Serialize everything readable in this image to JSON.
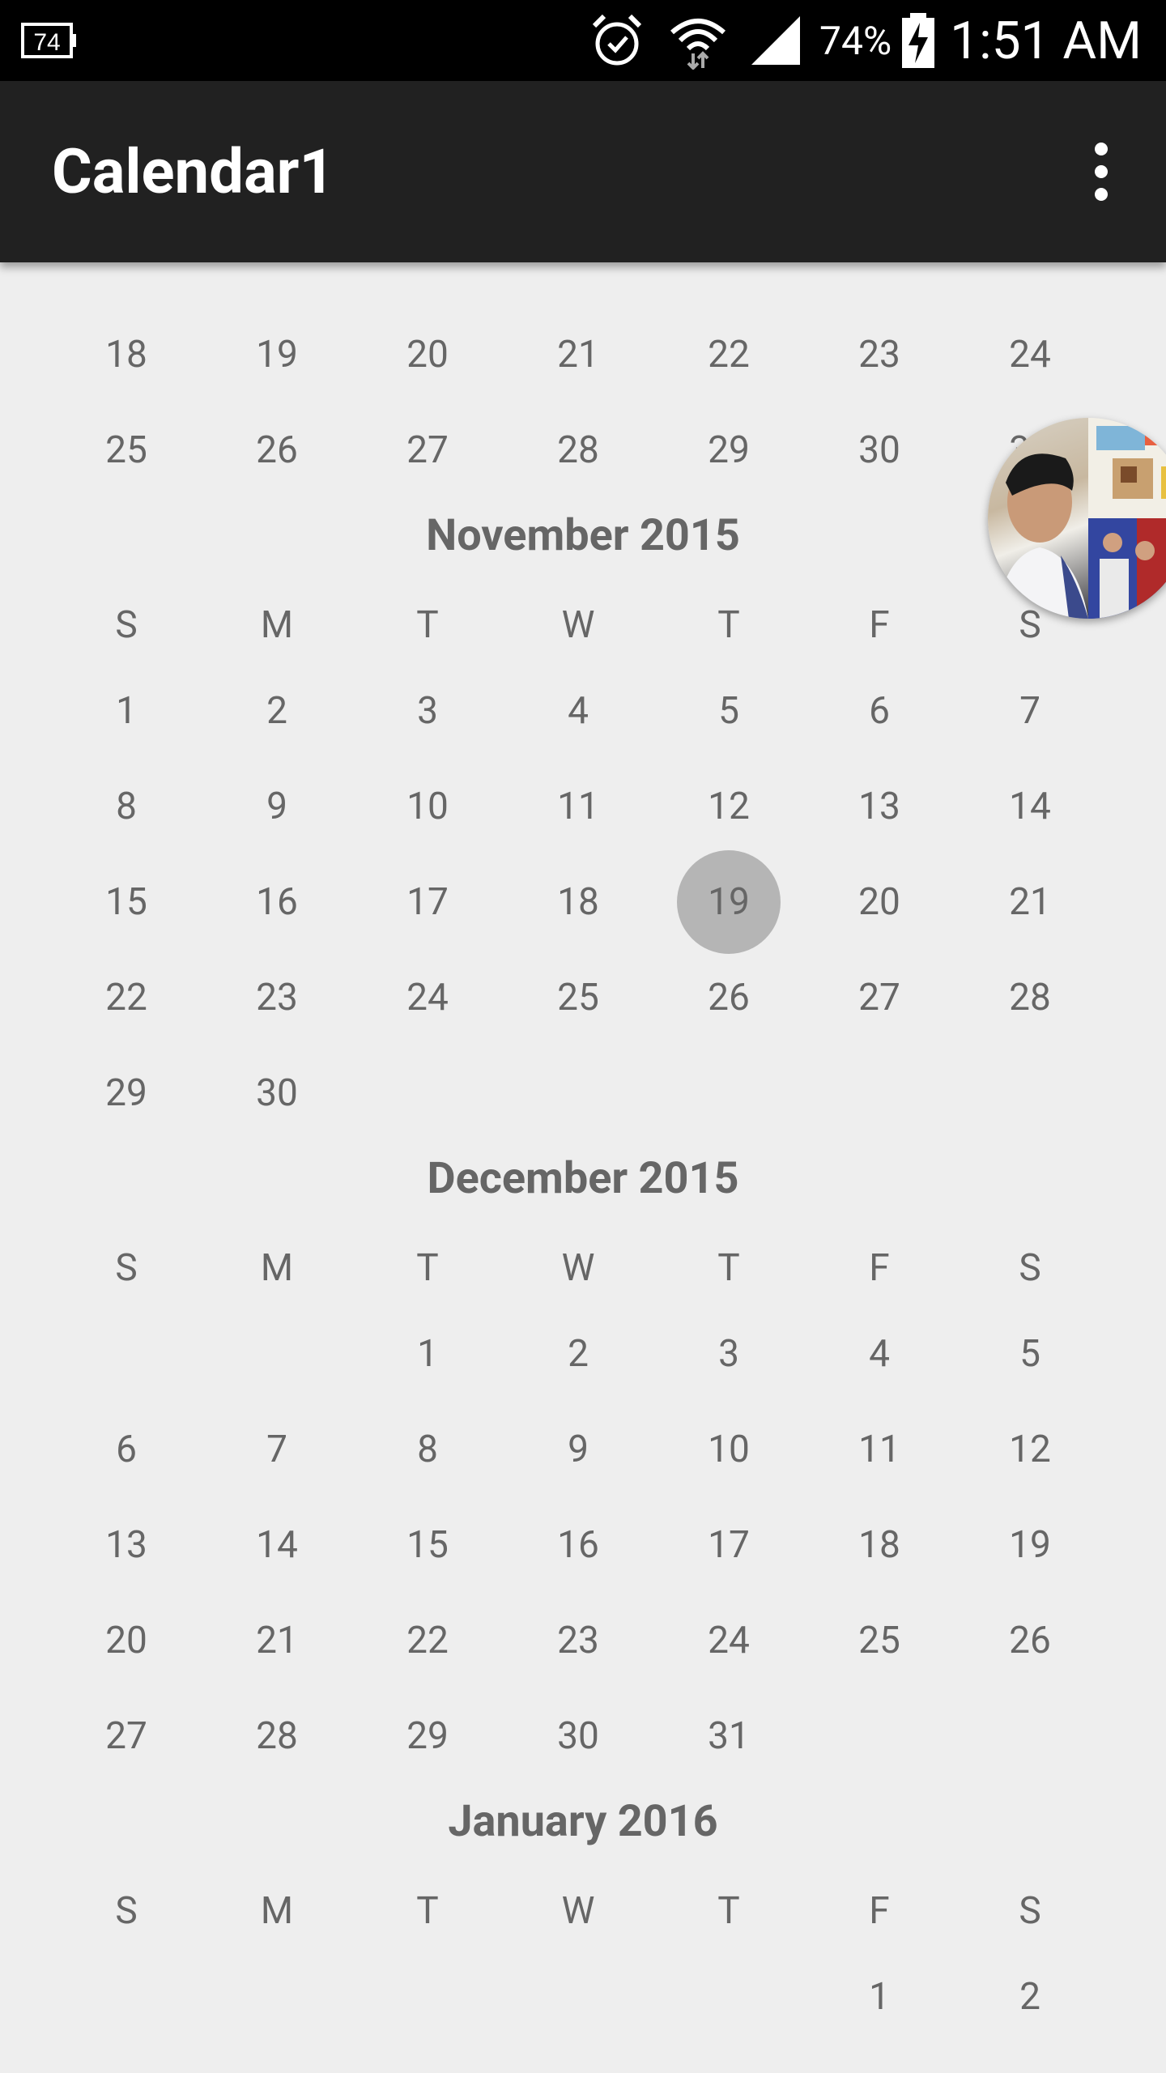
{
  "status_bar": {
    "notification": "74",
    "battery_percent": "74%",
    "time": "1:51 AM"
  },
  "app_bar": {
    "title": "Calendar1"
  },
  "previous_month_tail": {
    "weeks": [
      [
        "18",
        "19",
        "20",
        "21",
        "22",
        "23",
        "24"
      ],
      [
        "25",
        "26",
        "27",
        "28",
        "29",
        "30",
        "31"
      ]
    ]
  },
  "weekdays": [
    "S",
    "M",
    "T",
    "W",
    "T",
    "F",
    "S"
  ],
  "months": [
    {
      "title": "November 2015",
      "weeks": [
        [
          "1",
          "2",
          "3",
          "4",
          "5",
          "6",
          "7"
        ],
        [
          "8",
          "9",
          "10",
          "11",
          "12",
          "13",
          "14"
        ],
        [
          "15",
          "16",
          "17",
          "18",
          "19",
          "20",
          "21"
        ],
        [
          "22",
          "23",
          "24",
          "25",
          "26",
          "27",
          "28"
        ],
        [
          "29",
          "30",
          "",
          "",
          "",
          "",
          ""
        ]
      ],
      "selected_day": "19"
    },
    {
      "title": "December 2015",
      "weeks": [
        [
          "",
          "",
          "1",
          "2",
          "3",
          "4",
          "5"
        ],
        [
          "6",
          "7",
          "8",
          "9",
          "10",
          "11",
          "12"
        ],
        [
          "13",
          "14",
          "15",
          "16",
          "17",
          "18",
          "19"
        ],
        [
          "20",
          "21",
          "22",
          "23",
          "24",
          "25",
          "26"
        ],
        [
          "27",
          "28",
          "29",
          "30",
          "31",
          "",
          ""
        ]
      ]
    },
    {
      "title": "January 2016",
      "weeks": [
        [
          "",
          "",
          "",
          "",
          "",
          "1",
          "2"
        ]
      ]
    }
  ],
  "colors": {
    "status_bar_bg": "#000000",
    "app_bar_bg": "#212121",
    "background": "#eeeeee",
    "text": "#666666",
    "selected_circle": "#b5b5b5"
  },
  "icons": {
    "overflow": "more-vert-icon",
    "alarm": "alarm-icon",
    "wifi": "wifi-icon",
    "signal": "signal-icon",
    "battery": "battery-charging-icon",
    "notification": "notification-icon"
  }
}
